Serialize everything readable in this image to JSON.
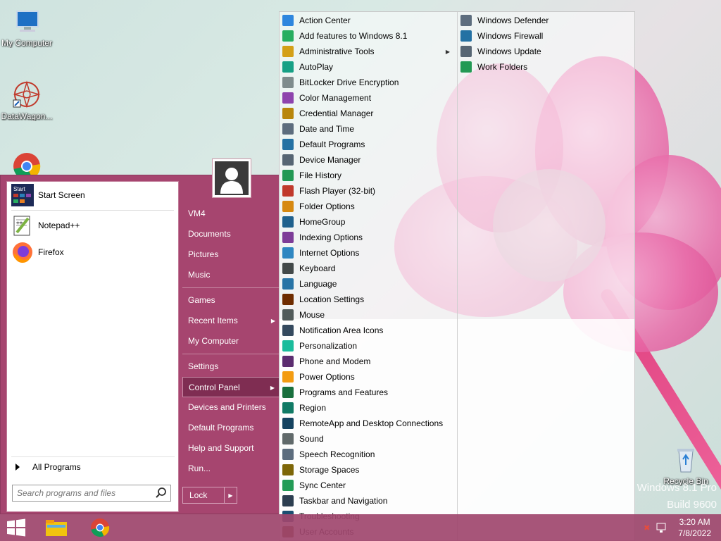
{
  "desktop": {
    "icons": [
      {
        "label": "My Computer",
        "icon": "computer-icon"
      },
      {
        "label": "DataWagon...",
        "icon": "datawagon-icon"
      },
      {
        "label": "Recycle Bin",
        "icon": "recycle-bin-icon"
      }
    ],
    "watermark_line1": "Windows 8.1 Pro",
    "watermark_line2": "Build 9600"
  },
  "start_menu": {
    "pinned": [
      {
        "label": "Start Screen",
        "icon": "start-screen-icon"
      },
      {
        "label": "Notepad++",
        "icon": "notepadpp-icon"
      },
      {
        "label": "Firefox",
        "icon": "firefox-icon"
      }
    ],
    "all_programs": "All Programs",
    "search_placeholder": "Search programs and files",
    "right_items": [
      {
        "label": "VM4"
      },
      {
        "label": "Documents"
      },
      {
        "label": "Pictures"
      },
      {
        "label": "Music"
      },
      {
        "label": "Games"
      },
      {
        "label": "Recent Items",
        "submenu": true
      },
      {
        "label": "My Computer"
      },
      {
        "label": "Settings"
      },
      {
        "label": "Control Panel",
        "submenu": true,
        "highlighted": true
      },
      {
        "label": "Devices and Printers"
      },
      {
        "label": "Default Programs"
      },
      {
        "label": "Help and Support"
      },
      {
        "label": "Run..."
      }
    ],
    "lock_label": "Lock"
  },
  "control_panel": {
    "column1": [
      "Action Center",
      "Add features to Windows 8.1",
      "Administrative Tools",
      "AutoPlay",
      "BitLocker Drive Encryption",
      "Color Management",
      "Credential Manager",
      "Date and Time",
      "Default Programs",
      "Device Manager",
      "File History",
      "Flash Player (32-bit)",
      "Folder Options",
      "HomeGroup",
      "Indexing Options",
      "Internet Options",
      "Keyboard",
      "Language",
      "Location Settings",
      "Mouse",
      "Notification Area Icons",
      "Personalization",
      "Phone and Modem",
      "Power Options",
      "Programs and Features",
      "Region",
      "RemoteApp and Desktop Connections",
      "Sound",
      "Speech Recognition",
      "Storage Spaces",
      "Sync Center",
      "Taskbar and Navigation",
      "Troubleshooting",
      "User Accounts"
    ],
    "column2": [
      "Windows Defender",
      "Windows Firewall",
      "Windows Update",
      "Work Folders"
    ],
    "submenu_item": "Administrative Tools"
  },
  "taskbar": {
    "time": "3:20 AM",
    "date": "7/8/2022"
  },
  "colors": {
    "accent": "#a6456f",
    "highlight": "#7f2d52"
  }
}
